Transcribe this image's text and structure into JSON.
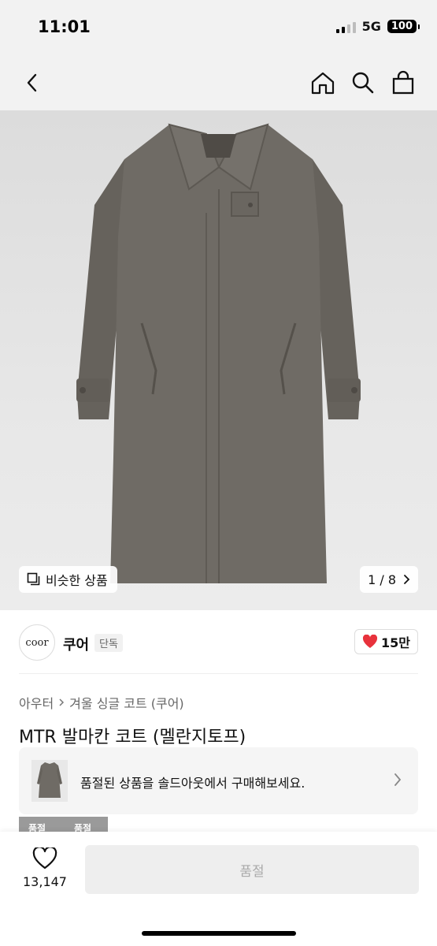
{
  "status_bar": {
    "time": "11:01",
    "network": "5G",
    "battery": "100"
  },
  "nav": {
    "back_icon": "chevron-left",
    "home_icon": "house",
    "search_icon": "magnifier",
    "cart_icon": "shopping-bag"
  },
  "image": {
    "similar_label": "비슷한 상품",
    "page": "1 / 8",
    "current": 1,
    "total": 8
  },
  "brand": {
    "logo_text": "coor",
    "name": "쿠어",
    "badge": "단독",
    "likes": "15만",
    "like_color": "#e8323c"
  },
  "breadcrumb": {
    "category": "아우터",
    "subcategory": "겨울 싱글 코트 (쿠어)"
  },
  "product": {
    "title": "MTR 발마칸 코트 (멜란지토프)"
  },
  "soldout_banner": {
    "text": "품절된 상품을 솔드아웃에서 구매해보세요."
  },
  "swatches": [
    "품절",
    "품절"
  ],
  "bottom": {
    "wish_count": "13,147",
    "buy_label": "품절"
  },
  "colors": {
    "background": "#ffffff",
    "header": "#f2f2f2",
    "coat": "#6f6b65",
    "disabled": "#eeeeee"
  }
}
